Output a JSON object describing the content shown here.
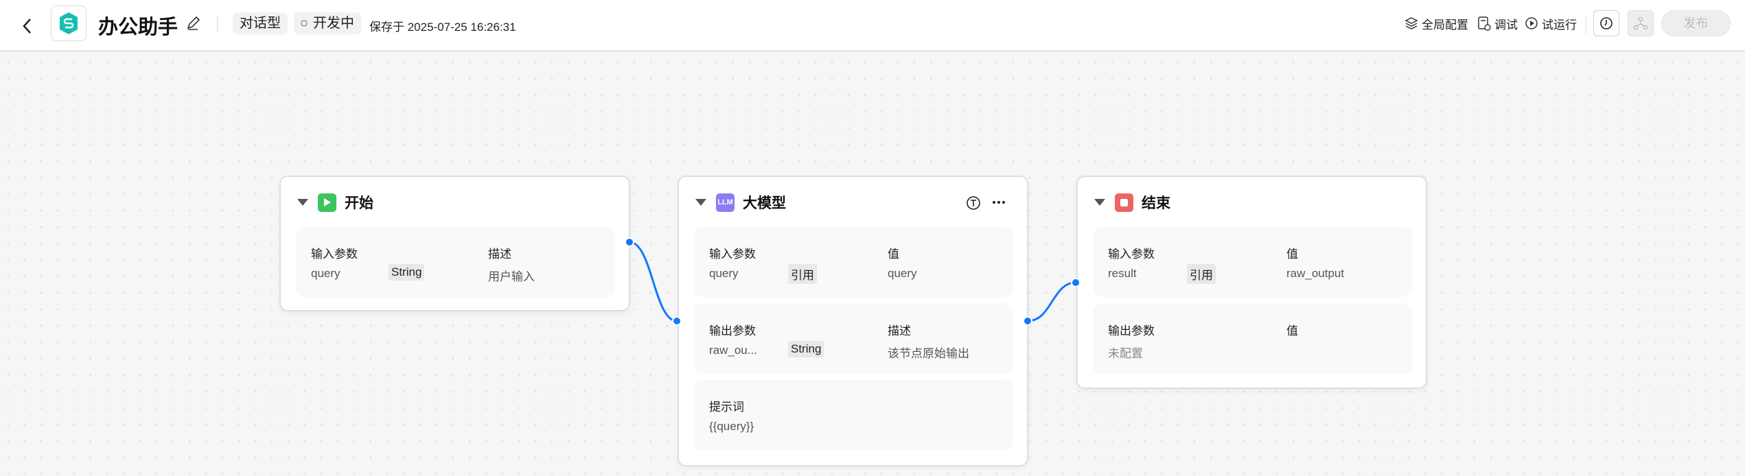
{
  "header": {
    "title": "办公助手",
    "tag_type": "对话型",
    "status": "开发中",
    "save_text": "保存于 2025-07-25 16:26:31",
    "tools": {
      "global_config": "全局配置",
      "debug": "调试",
      "test_run": "试运行"
    },
    "publish": "发布"
  },
  "nodes": {
    "start": {
      "title": "开始",
      "col1": "输入参数",
      "col2": "描述",
      "row": {
        "name": "query",
        "type": "String",
        "desc": "用户输入"
      }
    },
    "llm": {
      "title": "大模型",
      "icon_text": "LLM",
      "input": {
        "col1": "输入参数",
        "col2": "值",
        "row": {
          "name": "query",
          "type": "引用",
          "value": "query"
        }
      },
      "output": {
        "col1": "输出参数",
        "col2": "描述",
        "row": {
          "name": "raw_ou...",
          "type": "String",
          "desc": "该节点原始输出"
        }
      },
      "prompt": {
        "label": "提示词",
        "value": "{{query}}"
      }
    },
    "end": {
      "title": "结束",
      "input": {
        "col1": "输入参数",
        "col2": "值",
        "row": {
          "name": "result",
          "type": "引用",
          "value": "raw_output"
        }
      },
      "output": {
        "col1": "输出参数",
        "col2": "值",
        "empty": "未配置"
      }
    }
  },
  "colors": {
    "accent": "#1677ff",
    "start": "#3cc45d",
    "llm": "#8b7cf0",
    "end": "#ec6464"
  }
}
